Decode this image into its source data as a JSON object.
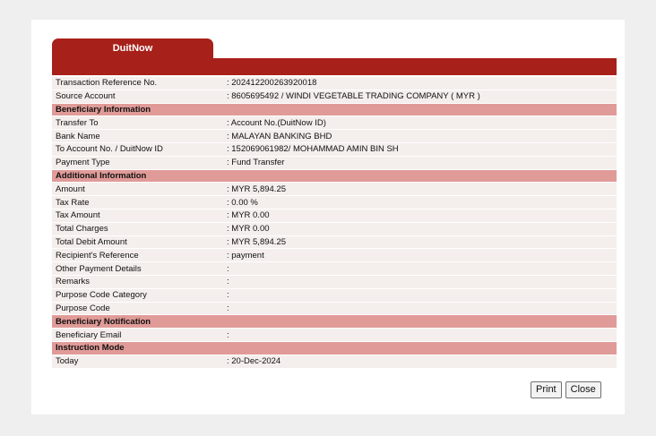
{
  "tab": {
    "label": "DuitNow"
  },
  "rows": [
    {
      "type": "field",
      "label": "Transaction Reference No.",
      "value": ": 202412200263920018"
    },
    {
      "type": "field",
      "label": "Source Account",
      "value": ": 8605695492 / WINDI VEGETABLE TRADING COMPANY ( MYR )"
    },
    {
      "type": "section",
      "label": "Beneficiary Information"
    },
    {
      "type": "field",
      "label": "Transfer To",
      "value": ": Account No.(DuitNow ID)"
    },
    {
      "type": "field",
      "label": "Bank Name",
      "value": ": MALAYAN BANKING BHD"
    },
    {
      "type": "field",
      "label": "To Account No. / DuitNow ID",
      "value": ": 152069061982/ MOHAMMAD AMIN BIN SH"
    },
    {
      "type": "field",
      "label": "Payment Type",
      "value": ": Fund Transfer"
    },
    {
      "type": "section",
      "label": "Additional Information"
    },
    {
      "type": "field",
      "label": "Amount",
      "value": ": MYR 5,894.25"
    },
    {
      "type": "field",
      "label": "Tax Rate",
      "value": ": 0.00 %"
    },
    {
      "type": "field",
      "label": "Tax Amount",
      "value": ": MYR 0.00"
    },
    {
      "type": "field",
      "label": "Total Charges",
      "value": ": MYR 0.00"
    },
    {
      "type": "field",
      "label": "Total Debit Amount",
      "value": ": MYR 5,894.25"
    },
    {
      "type": "field",
      "label": "Recipient's Reference",
      "value": ": payment"
    },
    {
      "type": "field",
      "label": "Other Payment Details",
      "value": ":"
    },
    {
      "type": "field",
      "label": "Remarks",
      "value": ":"
    },
    {
      "type": "field",
      "label": "Purpose Code Category",
      "value": ":"
    },
    {
      "type": "field",
      "label": "Purpose Code",
      "value": ":"
    },
    {
      "type": "section",
      "label": "Beneficiary Notification"
    },
    {
      "type": "field",
      "label": "Beneficiary Email",
      "value": ":"
    },
    {
      "type": "section",
      "label": "Instruction Mode"
    },
    {
      "type": "field",
      "label": "Today",
      "value": ": 20-Dec-2024"
    }
  ],
  "buttons": {
    "print": "Print",
    "close": "Close"
  },
  "colors": {
    "header": "#a8201a",
    "section": "#e09b98",
    "row": "#f4eeec"
  }
}
